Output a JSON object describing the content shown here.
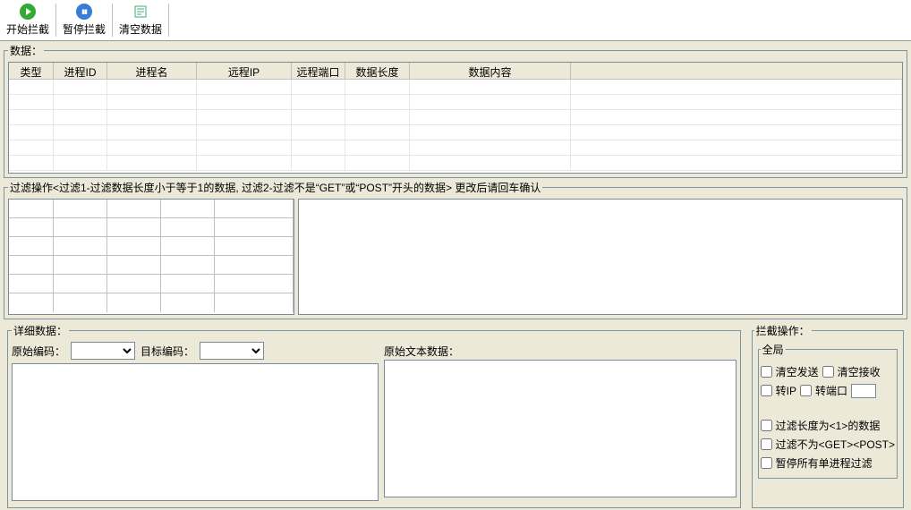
{
  "toolbar": {
    "start": "开始拦截",
    "pause": "暂停拦截",
    "clear": "清空数据"
  },
  "data_section": {
    "legend": "数据：",
    "columns": {
      "type": "类型",
      "pid": "进程ID",
      "pname": "进程名",
      "rip": "远程IP",
      "rport": "远程端口",
      "dlen": "数据长度",
      "content": "数据内容"
    }
  },
  "filter_section": {
    "legend": "过滤操作<过滤1-过滤数据长度小于等于1的数据, 过滤2-过滤不是“GET”或“POST”开头的数据> 更改后请回车确认"
  },
  "detail_section": {
    "legend": "详细数据：",
    "src_enc_label": "原始编码：",
    "dst_enc_label": "目标编码：",
    "raw_text_label": "原始文本数据："
  },
  "intercept_section": {
    "legend": "拦截操作：",
    "global_legend": "全局",
    "clear_send": "清空发送",
    "clear_recv": "清空接收",
    "fwd_ip": "转IP",
    "fwd_port": "转端口",
    "filter_len": "过滤长度为<1>的数据",
    "filter_getpost": "过滤不为<GET><POST>",
    "pause_single": "暂停所有单进程过滤"
  }
}
